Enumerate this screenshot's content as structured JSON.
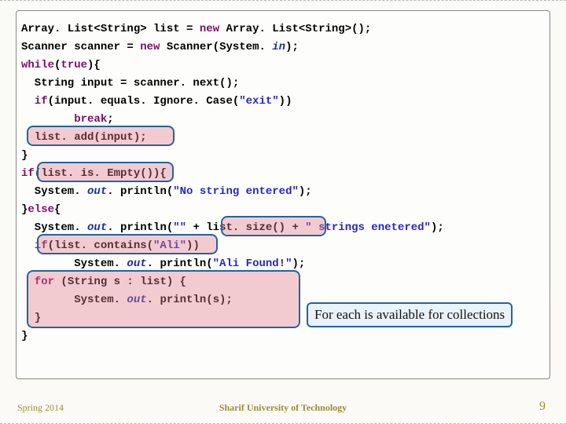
{
  "code": {
    "l1a": "Array. List<String> list = ",
    "l1b": "new",
    "l1c": " Array. List<String>();",
    "l2a": "Scanner scanner = ",
    "l2b": "new",
    "l2c": " Scanner(System.",
    "l2d": " in",
    "l2e": ");",
    "l3a": "while",
    "l3b": "(",
    "l3c": "true",
    "l3d": "){",
    "l4": "  String input = scanner. next();",
    "l5a": "  if",
    "l5b": "(input. equals. Ignore. Case(",
    "l5c": "\"exit\"",
    "l5d": "))",
    "l6a": "        break",
    "l6b": ";",
    "l7": "  list. add(input);",
    "l8": "}",
    "l9a": "if",
    "l9b": "(list. is. Empty()){",
    "l10a": "  System.",
    "l10b": " out",
    "l10c": ". println(",
    "l10d": "\"No string entered\"",
    "l10e": ");",
    "l11a": "}",
    "l11b": "else",
    "l11c": "{",
    "l12a": "  System.",
    "l12b": " out",
    "l12c": ". println(",
    "l12d": "\"\"",
    "l12e": " + list. size() + ",
    "l12f": "\" strings enetered\"",
    "l12g": ");",
    "l13a": "  if",
    "l13b": "(list. contains(",
    "l13c": "\"Ali\"",
    "l13d": "))",
    "l14a": "        System.",
    "l14b": " out",
    "l14c": ". println(",
    "l14d": "\"Ali Found!\"",
    "l14e": ");",
    "l15a": "  for",
    "l15b": " (String s : list) {",
    "l16a": "        System.",
    "l16b": " out",
    "l16c": ". println(s);",
    "l17": "  }",
    "l18": "}"
  },
  "note": "For each is available for collections",
  "footer": {
    "left": "Spring 2014",
    "center": "Sharif University of Technology",
    "right": "9"
  }
}
